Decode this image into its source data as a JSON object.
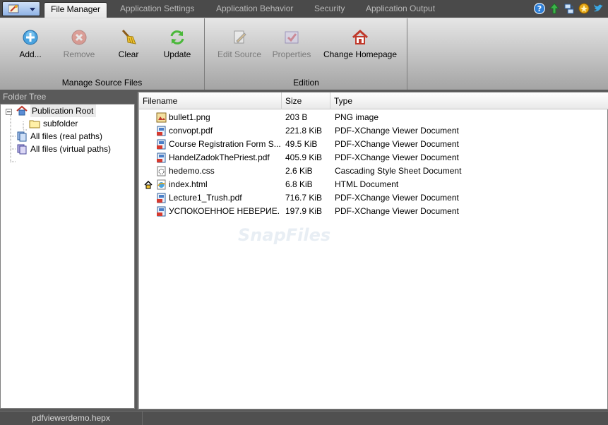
{
  "tabs": [
    "File Manager",
    "Application Settings",
    "Application Behavior",
    "Security",
    "Application Output"
  ],
  "ribbon": {
    "groups": [
      {
        "label": "Manage Source Files",
        "buttons": [
          {
            "label": "Add...",
            "icon": "add-icon",
            "enabled": true
          },
          {
            "label": "Remove",
            "icon": "remove-icon",
            "enabled": false
          },
          {
            "label": "Clear",
            "icon": "broom-icon",
            "enabled": true
          },
          {
            "label": "Update",
            "icon": "refresh-icon",
            "enabled": true
          }
        ]
      },
      {
        "label": "Edition",
        "buttons": [
          {
            "label": "Edit Source",
            "icon": "edit-icon",
            "enabled": false
          },
          {
            "label": "Properties",
            "icon": "properties-icon",
            "enabled": false
          },
          {
            "label": "Change Homepage",
            "icon": "home-icon",
            "enabled": true
          }
        ]
      }
    ]
  },
  "folder_tree": {
    "title": "Folder Tree",
    "nodes": [
      {
        "label": "Publication Root",
        "icon": "home-folder-icon",
        "selected": true
      },
      {
        "label": "subfolder",
        "icon": "folder-icon"
      },
      {
        "label": "All files (real paths)",
        "icon": "files-icon"
      },
      {
        "label": "All files (virtual paths)",
        "icon": "files-icon"
      }
    ]
  },
  "file_list": {
    "columns": [
      "Filename",
      "Size",
      "Type"
    ],
    "rows": [
      {
        "name": "bullet1.png",
        "size": "203 B",
        "type": "PNG image",
        "icon": "image-file-icon"
      },
      {
        "name": "convopt.pdf",
        "size": "221.8 KiB",
        "type": "PDF-XChange Viewer Document",
        "icon": "pdf-file-icon"
      },
      {
        "name": "Course Registration Form S...",
        "size": "49.5 KiB",
        "type": "PDF-XChange Viewer Document",
        "icon": "pdf-file-icon"
      },
      {
        "name": "HandelZadokThePriest.pdf",
        "size": "405.9 KiB",
        "type": "PDF-XChange Viewer Document",
        "icon": "pdf-file-icon"
      },
      {
        "name": "hedemo.css",
        "size": "2.6 KiB",
        "type": "Cascading Style Sheet Document",
        "icon": "css-file-icon"
      },
      {
        "name": "index.html",
        "size": "6.8 KiB",
        "type": "HTML Document",
        "icon": "html-file-icon",
        "homepage": true
      },
      {
        "name": "Lecture1_Trush.pdf",
        "size": "716.7 KiB",
        "type": "PDF-XChange Viewer Document",
        "icon": "pdf-file-icon"
      },
      {
        "name": "УСПОКОЕННОЕ НЕВЕРИЕ....",
        "size": "197.9 KiB",
        "type": "PDF-XChange Viewer Document",
        "icon": "pdf-file-icon"
      }
    ]
  },
  "watermark": "SnapFiles",
  "status": {
    "project_file": "pdfviewerdemo.hepx"
  }
}
